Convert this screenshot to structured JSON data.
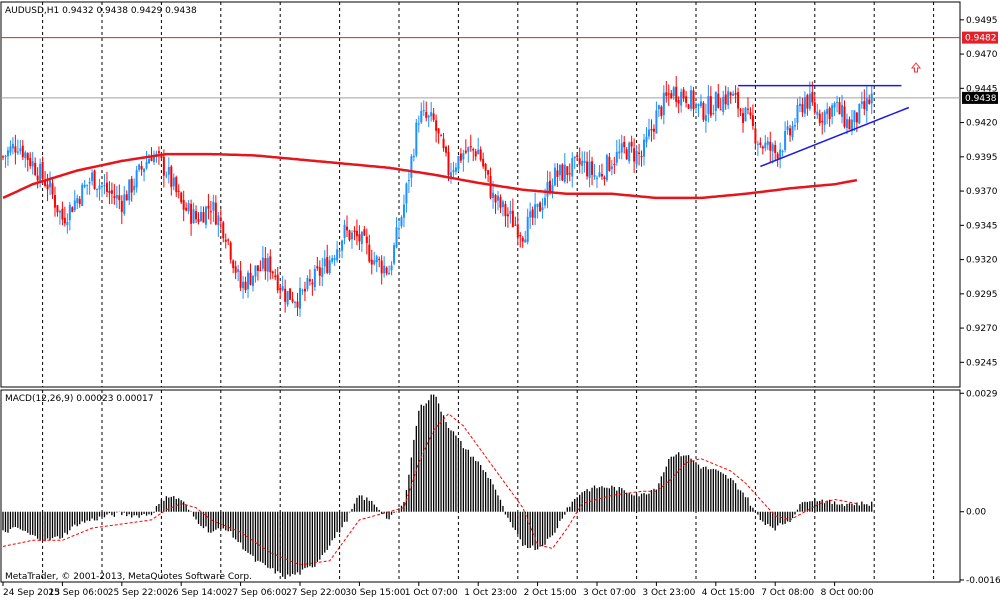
{
  "header": {
    "symbol_info": "AUDUSD,H1  0.9432 0.9438 0.9429 0.9438"
  },
  "macd": {
    "label": "MACD(12,26,9) 0.00023 0.00017"
  },
  "footer": {
    "copyright": "MetaTrader, © 2001-2013, MetaQuotes Software Corp."
  },
  "colors": {
    "background": "#ffffff",
    "grid": "#000000",
    "bull": "#1e90ff",
    "bear": "#ff0000",
    "ma": "#e8141c",
    "trend": "#1a1ae6",
    "hline": "#e0222a",
    "macd_hist": "#000000",
    "signal": "#ff0000"
  },
  "chart_data": [
    {
      "type": "candlestick",
      "symbol": "AUDUSD",
      "timeframe": "H1",
      "title": "AUDUSD,H1  0.9432 0.9438 0.9429 0.9438",
      "ylim": [
        0.9227,
        0.9508
      ],
      "y_ticks": [
        "0.9495",
        "0.9470",
        "0.9445",
        "0.9420",
        "0.9395",
        "0.9370",
        "0.9345",
        "0.9320",
        "0.9295",
        "0.9270",
        "0.9245"
      ],
      "x_ticks": [
        "24 Sep 2013",
        "25 Sep 06:00",
        "25 Sep 22:00",
        "26 Sep 14:00",
        "27 Sep 06:00",
        "27 Sep 22:00",
        "30 Sep 15:00",
        "1 Oct 07:00",
        "1 Oct 23:00",
        "2 Oct 15:00",
        "3 Oct 07:00",
        "3 Oct 23:00",
        "4 Oct 15:00",
        "7 Oct 08:00",
        "8 Oct 00:00"
      ],
      "current_price": "0.9438",
      "hline_label": "0.9482",
      "hline_value": 0.9482,
      "close_path": [
        [
          0,
          0.9395
        ],
        [
          6,
          0.9405
        ],
        [
          12,
          0.939
        ],
        [
          18,
          0.9375
        ],
        [
          24,
          0.935
        ],
        [
          30,
          0.9365
        ],
        [
          36,
          0.938
        ],
        [
          42,
          0.937
        ],
        [
          48,
          0.9362
        ],
        [
          54,
          0.938
        ],
        [
          60,
          0.9398
        ],
        [
          66,
          0.9385
        ],
        [
          72,
          0.936
        ],
        [
          78,
          0.935
        ],
        [
          84,
          0.936
        ],
        [
          90,
          0.934
        ],
        [
          96,
          0.93
        ],
        [
          102,
          0.9312
        ],
        [
          108,
          0.9316
        ],
        [
          114,
          0.9295
        ],
        [
          120,
          0.9292
        ],
        [
          126,
          0.9306
        ],
        [
          132,
          0.932
        ],
        [
          138,
          0.934
        ],
        [
          144,
          0.9335
        ],
        [
          150,
          0.932
        ],
        [
          156,
          0.9312
        ],
        [
          162,
          0.936
        ],
        [
          168,
          0.9425
        ],
        [
          174,
          0.942
        ],
        [
          180,
          0.9385
        ],
        [
          186,
          0.9398
        ],
        [
          192,
          0.94
        ],
        [
          198,
          0.9365
        ],
        [
          204,
          0.9352
        ],
        [
          210,
          0.934
        ],
        [
          216,
          0.9355
        ],
        [
          222,
          0.938
        ],
        [
          228,
          0.9385
        ],
        [
          234,
          0.939
        ],
        [
          240,
          0.938
        ],
        [
          246,
          0.9393
        ],
        [
          252,
          0.94
        ],
        [
          258,
          0.9395
        ],
        [
          264,
          0.9425
        ],
        [
          270,
          0.9443
        ],
        [
          276,
          0.944
        ],
        [
          282,
          0.9428
        ],
        [
          288,
          0.9435
        ],
        [
          294,
          0.944
        ],
        [
          300,
          0.9425
        ],
        [
          306,
          0.9405
        ],
        [
          312,
          0.9398
        ],
        [
          318,
          0.9412
        ],
        [
          324,
          0.9438
        ],
        [
          330,
          0.9425
        ],
        [
          336,
          0.9432
        ],
        [
          342,
          0.9418
        ],
        [
          348,
          0.943
        ],
        [
          351,
          0.9438
        ]
      ],
      "moving_average": [
        [
          0,
          0.9365
        ],
        [
          12,
          0.9375
        ],
        [
          30,
          0.9385
        ],
        [
          48,
          0.9392
        ],
        [
          66,
          0.9397
        ],
        [
          84,
          0.9397
        ],
        [
          102,
          0.9396
        ],
        [
          120,
          0.9393
        ],
        [
          138,
          0.939
        ],
        [
          156,
          0.9387
        ],
        [
          174,
          0.9382
        ],
        [
          192,
          0.9376
        ],
        [
          210,
          0.9371
        ],
        [
          228,
          0.9368
        ],
        [
          246,
          0.9368
        ],
        [
          264,
          0.9365
        ],
        [
          282,
          0.9365
        ],
        [
          300,
          0.9368
        ],
        [
          318,
          0.9372
        ],
        [
          336,
          0.9375
        ],
        [
          345,
          0.9378
        ]
      ],
      "trendlines": [
        {
          "from": [
            297,
            0.9447
          ],
          "to": [
            363,
            0.9447
          ]
        },
        {
          "from": [
            306,
            0.9388
          ],
          "to": [
            366,
            0.9431
          ]
        }
      ]
    },
    {
      "type": "histogram",
      "title": "MACD(12,26,9) 0.00023 0.00017",
      "ylim": [
        -0.00172,
        0.00298
      ],
      "y_ticks": [
        "0.0029",
        "0.00",
        "-0.00167"
      ],
      "macd_path": [
        [
          0,
          -0.0005
        ],
        [
          6,
          -0.0004
        ],
        [
          12,
          -0.0006
        ],
        [
          18,
          -0.0007
        ],
        [
          24,
          -0.0006
        ],
        [
          30,
          -0.0003
        ],
        [
          36,
          -0.0002
        ],
        [
          42,
          -0.0001
        ],
        [
          48,
          -5e-05
        ],
        [
          54,
          -0.0001
        ],
        [
          60,
          -5e-05
        ],
        [
          66,
          0.0004
        ],
        [
          72,
          0.0003
        ],
        [
          78,
          -0.0002
        ],
        [
          84,
          -0.0005
        ],
        [
          90,
          -0.0004
        ],
        [
          96,
          -0.0008
        ],
        [
          102,
          -0.0012
        ],
        [
          108,
          -0.0014
        ],
        [
          114,
          -0.0016
        ],
        [
          120,
          -0.0015
        ],
        [
          126,
          -0.0013
        ],
        [
          132,
          -0.0008
        ],
        [
          138,
          -0.0003
        ],
        [
          144,
          0.0004
        ],
        [
          150,
          0.0002
        ],
        [
          156,
          -0.0002
        ],
        [
          162,
          0.0002
        ],
        [
          168,
          0.0025
        ],
        [
          174,
          0.0029
        ],
        [
          180,
          0.0021
        ],
        [
          186,
          0.0016
        ],
        [
          192,
          0.0012
        ],
        [
          198,
          0.0007
        ],
        [
          204,
          -0.0002
        ],
        [
          210,
          -0.0008
        ],
        [
          216,
          -0.0009
        ],
        [
          222,
          -0.0006
        ],
        [
          228,
          0.0001
        ],
        [
          234,
          0.0005
        ],
        [
          240,
          0.0006
        ],
        [
          246,
          0.0006
        ],
        [
          252,
          0.0005
        ],
        [
          258,
          0.0004
        ],
        [
          264,
          0.0006
        ],
        [
          270,
          0.0014
        ],
        [
          276,
          0.0014
        ],
        [
          282,
          0.0011
        ],
        [
          288,
          0.001
        ],
        [
          294,
          0.0008
        ],
        [
          300,
          0.0004
        ],
        [
          306,
          -0.0002
        ],
        [
          312,
          -0.0004
        ],
        [
          318,
          -0.0002
        ],
        [
          324,
          0.0003
        ],
        [
          330,
          0.0003
        ],
        [
          336,
          0.0002
        ],
        [
          342,
          0.0002
        ],
        [
          351,
          0.0002
        ]
      ],
      "signal_path": [
        [
          0,
          -0.00085
        ],
        [
          12,
          -0.0007
        ],
        [
          24,
          -0.0007
        ],
        [
          36,
          -0.0004
        ],
        [
          48,
          -0.0003
        ],
        [
          60,
          -0.0002
        ],
        [
          66,
          5e-05
        ],
        [
          72,
          0.0002
        ],
        [
          78,
          0.0001
        ],
        [
          84,
          -0.0002
        ],
        [
          96,
          -0.0005
        ],
        [
          108,
          -0.001
        ],
        [
          120,
          -0.0013
        ],
        [
          132,
          -0.0012
        ],
        [
          144,
          -0.0002
        ],
        [
          156,
          0.0
        ],
        [
          162,
          0.0001
        ],
        [
          168,
          0.0012
        ],
        [
          174,
          0.002
        ],
        [
          180,
          0.0024
        ],
        [
          186,
          0.0021
        ],
        [
          198,
          0.0011
        ],
        [
          210,
          0.0001
        ],
        [
          216,
          -0.0008
        ],
        [
          222,
          -0.0009
        ],
        [
          228,
          -0.0004
        ],
        [
          234,
          0.0002
        ],
        [
          246,
          0.0004
        ],
        [
          258,
          0.0005
        ],
        [
          264,
          0.0005
        ],
        [
          270,
          0.0008
        ],
        [
          276,
          0.0012
        ],
        [
          282,
          0.0013
        ],
        [
          294,
          0.001
        ],
        [
          300,
          0.0007
        ],
        [
          306,
          0.0003
        ],
        [
          312,
          -0.0001
        ],
        [
          318,
          -0.0002
        ],
        [
          324,
          0.0
        ],
        [
          330,
          0.0002
        ],
        [
          336,
          0.0003
        ],
        [
          345,
          0.0002
        ]
      ]
    }
  ]
}
